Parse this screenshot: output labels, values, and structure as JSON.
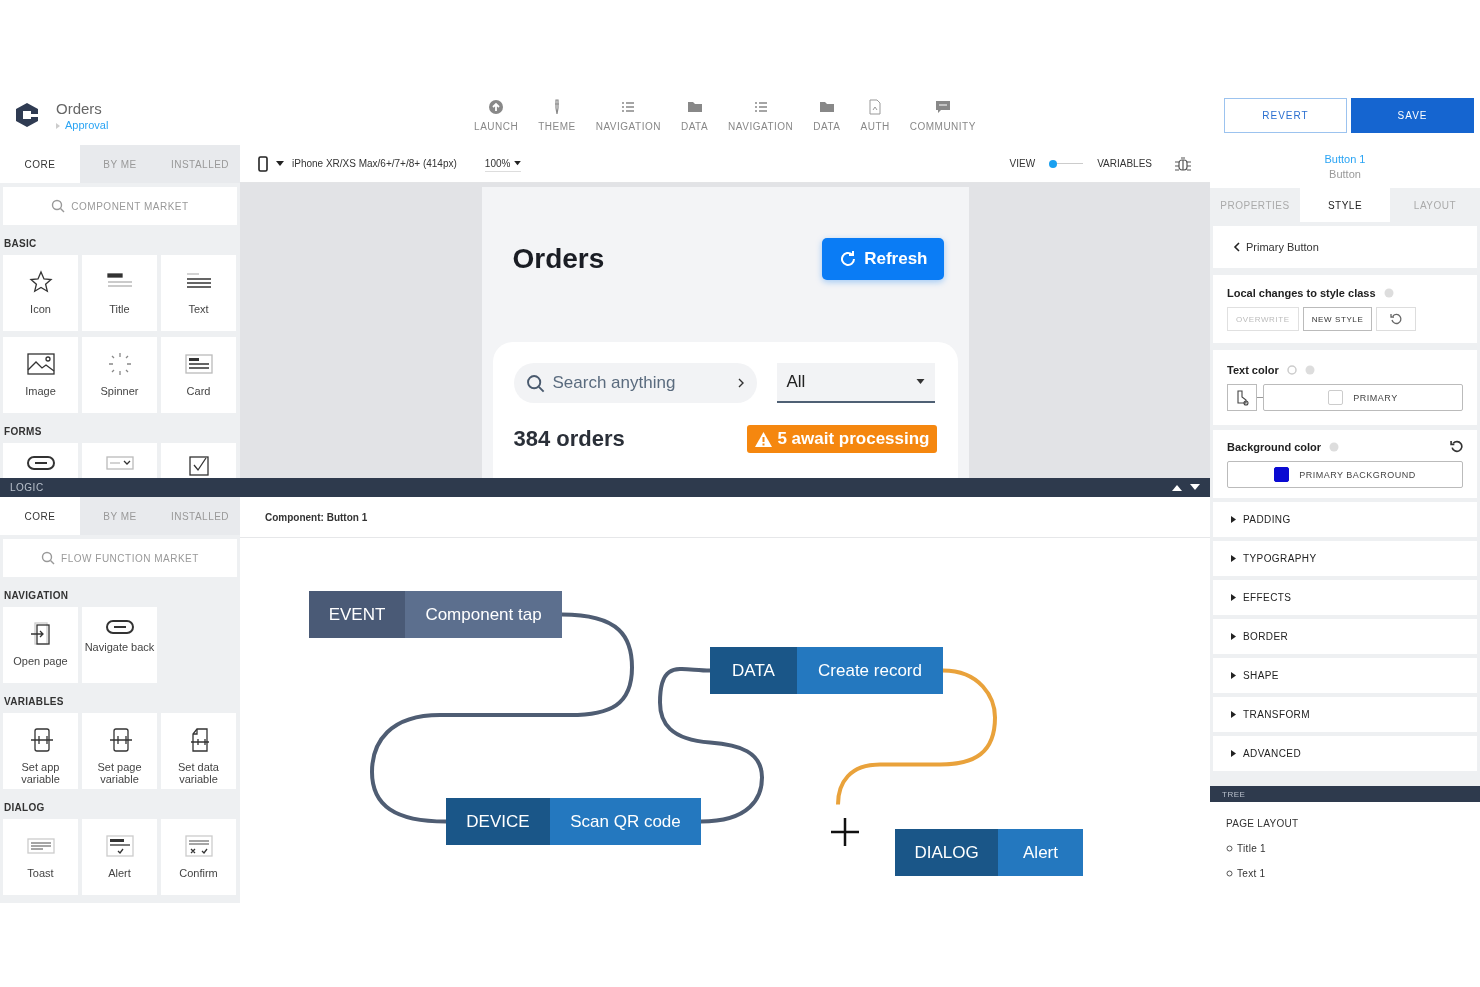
{
  "header": {
    "title": "Orders",
    "breadcrumb": "Approval",
    "nav": [
      {
        "label": "LAUNCH",
        "kind": "upload"
      },
      {
        "label": "THEME",
        "kind": "pen"
      },
      {
        "label": "NAVIGATION",
        "kind": "list"
      },
      {
        "label": "DATA",
        "kind": "folder"
      },
      {
        "label": "NAVIGATION",
        "kind": "list"
      },
      {
        "label": "DATA",
        "kind": "folder"
      },
      {
        "label": "AUTH",
        "kind": "document"
      },
      {
        "label": "COMMUNITY",
        "kind": "chat"
      }
    ],
    "revert": "REVERT",
    "save": "SAVE"
  },
  "components_panel": {
    "tabs": [
      {
        "label": "CORE",
        "selected": true
      },
      {
        "label": "BY ME",
        "selected": false
      },
      {
        "label": "INSTALLED",
        "selected": false
      }
    ],
    "search_placeholder": "COMPONENT MARKET",
    "groups": [
      {
        "title": "BASIC",
        "items": [
          {
            "label": "Icon",
            "kind": "star"
          },
          {
            "label": "Title",
            "kind": "title"
          },
          {
            "label": "Text",
            "kind": "text"
          },
          {
            "label": "Image",
            "kind": "image"
          },
          {
            "label": "Spinner",
            "kind": "spinner"
          },
          {
            "label": "Card",
            "kind": "card"
          }
        ]
      },
      {
        "title": "FORMS",
        "items": [
          {
            "kind": "button"
          },
          {
            "kind": "select"
          },
          {
            "kind": "checkbox"
          }
        ]
      }
    ]
  },
  "toolbar": {
    "device": "iPhone XR/XS Max/6+/7+/8+ (414px)",
    "zoom": "100%",
    "view_label": "VIEW",
    "variables_on": false,
    "variables_label": "VARIABLES"
  },
  "preview": {
    "title": "Orders",
    "refresh": "Refresh",
    "search_placeholder": "Search anything",
    "filter": "All",
    "count": "384 orders",
    "alert": "5 await processing"
  },
  "logic_bar": {
    "title": "LOGIC"
  },
  "logic_panel": {
    "tabs": [
      {
        "label": "CORE",
        "selected": true
      },
      {
        "label": "BY ME",
        "selected": false
      },
      {
        "label": "INSTALLED",
        "selected": false
      }
    ],
    "search_placeholder": "FLOW FUNCTION MARKET",
    "groups": [
      {
        "title": "NAVIGATION",
        "items": [
          {
            "label": "Open page",
            "kind": "page"
          },
          {
            "label": "Navigate back",
            "kind": "button"
          }
        ]
      },
      {
        "title": "VARIABLES",
        "items": [
          {
            "label": "Set app variable",
            "kind": "appvar"
          },
          {
            "label": "Set page variable",
            "kind": "pagevar"
          },
          {
            "label": "Set data variable",
            "kind": "datavar"
          }
        ]
      },
      {
        "title": "DIALOG",
        "items": [
          {
            "label": "Toast",
            "kind": "toast"
          },
          {
            "label": "Alert",
            "kind": "alert"
          },
          {
            "label": "Confirm",
            "kind": "confirm"
          }
        ]
      }
    ]
  },
  "flow": {
    "context": "Component: Button 1",
    "nodes": [
      {
        "type": "EVENT",
        "label": "Component tap",
        "kind": "event"
      },
      {
        "type": "DATA",
        "label": "Create record",
        "kind": "action"
      },
      {
        "type": "DEVICE",
        "label": "Scan QR code",
        "kind": "action"
      },
      {
        "type": "DIALOG",
        "label": "Alert",
        "kind": "action"
      }
    ],
    "edges": [
      {
        "active": false
      },
      {
        "active": false
      },
      {
        "active": true
      }
    ]
  },
  "inspector": {
    "component": "Button 1",
    "component_type": "Button",
    "tabs": [
      {
        "label": "PROPERTIES",
        "selected": false
      },
      {
        "label": "STYLE",
        "selected": true
      },
      {
        "label": "LAYOUT",
        "selected": false
      }
    ],
    "style_class": "Primary Button",
    "local_changes": {
      "label": "Local changes to style class",
      "buttons": [
        {
          "label": "OVERWRITE",
          "disabled": true
        },
        {
          "label": "NEW STYLE",
          "disabled": false
        }
      ]
    },
    "text_color": {
      "label": "Text color",
      "value": "PRIMARY",
      "color": "#ffffff"
    },
    "background_color": {
      "label": "Background color",
      "value": "PRIMARY BACKGROUND",
      "color": "#0a0ad2"
    },
    "sections": [
      {
        "label": "PADDING",
        "expanded": false
      },
      {
        "label": "TYPOGRAPHY",
        "expanded": false
      },
      {
        "label": "EFFECTS",
        "expanded": false
      },
      {
        "label": "BORDER",
        "expanded": false
      },
      {
        "label": "SHAPE",
        "expanded": false
      },
      {
        "label": "TRANSFORM",
        "expanded": false
      },
      {
        "label": "ADVANCED",
        "expanded": false
      }
    ]
  },
  "tree": {
    "title": "TREE",
    "items": [
      {
        "label": "PAGE LAYOUT",
        "children": [
          {
            "label": "Title 1"
          },
          {
            "label": "Text 1"
          }
        ]
      }
    ]
  }
}
